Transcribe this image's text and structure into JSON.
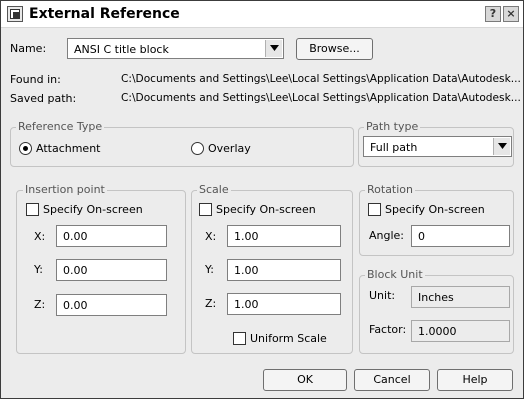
{
  "window": {
    "title": "External Reference",
    "help_label": "?",
    "close_label": "×"
  },
  "name_row": {
    "label": "Name:",
    "value": "ANSI C title block",
    "browse_label": "Browse..."
  },
  "found_in": {
    "label": "Found in:",
    "value": "C:\\Documents and Settings\\Lee\\Local Settings\\Application Data\\Autodesk..."
  },
  "saved_path": {
    "label": "Saved path:",
    "value": "C:\\Documents and Settings\\Lee\\Local Settings\\Application Data\\Autodesk..."
  },
  "reference_type": {
    "title": "Reference Type",
    "attachment_label": "Attachment",
    "overlay_label": "Overlay",
    "selected": "Attachment"
  },
  "path_type": {
    "title": "Path type",
    "value": "Full path"
  },
  "insertion": {
    "title": "Insertion point",
    "specify_label": "Specify On-screen",
    "x_label": "X:",
    "x": "0.00",
    "y_label": "Y:",
    "y": "0.00",
    "z_label": "Z:",
    "z": "0.00"
  },
  "scale": {
    "title": "Scale",
    "specify_label": "Specify On-screen",
    "x_label": "X:",
    "x": "1.00",
    "y_label": "Y:",
    "y": "1.00",
    "z_label": "Z:",
    "z": "1.00",
    "uniform_label": "Uniform Scale"
  },
  "rotation": {
    "title": "Rotation",
    "specify_label": "Specify On-screen",
    "angle_label": "Angle:",
    "angle": "0"
  },
  "block_unit": {
    "title": "Block Unit",
    "unit_label": "Unit:",
    "unit": "Inches",
    "factor_label": "Factor:",
    "factor": "1.0000"
  },
  "buttons": {
    "ok": "OK",
    "cancel": "Cancel",
    "help": "Help"
  },
  "icons": {
    "app": "xref-icon",
    "dropdown": "chevron-down-icon"
  }
}
